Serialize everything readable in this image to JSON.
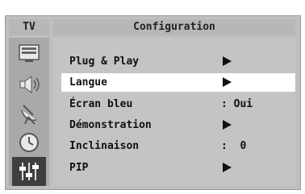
{
  "header": {
    "tv_tab": "TV",
    "title": "Configuration"
  },
  "sidebar": {
    "icons": [
      {
        "name": "picture-icon"
      },
      {
        "name": "sound-icon"
      },
      {
        "name": "channel-antenna-icon"
      },
      {
        "name": "timer-clock-icon"
      },
      {
        "name": "setup-sliders-icon",
        "active": true
      }
    ]
  },
  "menu": {
    "items": [
      {
        "label": "Plug & Play",
        "value": "",
        "arrow": true,
        "selected": false
      },
      {
        "label": "Langue",
        "value": "",
        "arrow": true,
        "selected": true
      },
      {
        "label": "Écran bleu",
        "value": ": Oui",
        "arrow": false,
        "selected": false
      },
      {
        "label": "Démonstration",
        "value": "",
        "arrow": true,
        "selected": false
      },
      {
        "label": "Inclinaison",
        "value": ":  0",
        "arrow": false,
        "selected": false
      },
      {
        "label": "PIP",
        "value": "",
        "arrow": true,
        "selected": false
      }
    ]
  },
  "colors": {
    "frame": "#bfbfbf",
    "panel": "#c4c4c4",
    "selected_row": "#ffffff",
    "active_icon_bg": "#3e3e3e"
  }
}
